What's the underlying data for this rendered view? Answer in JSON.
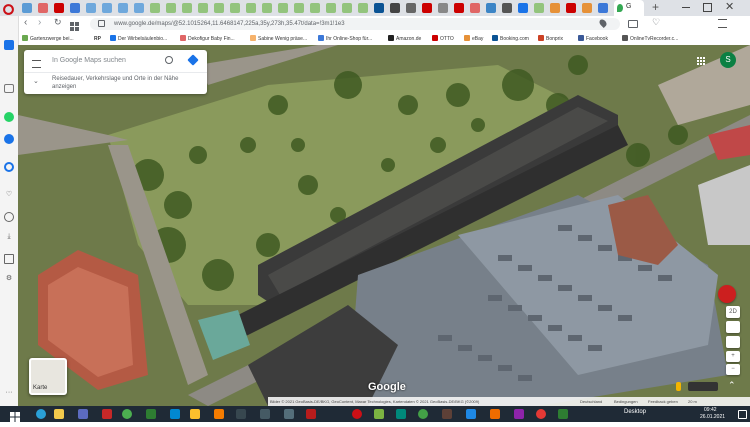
{
  "browser": {
    "url": "www.google.de/maps/@52.1015264,11.6468147,225a,35y,273h,35.47t/data=!3m1!1e3",
    "active_tab_label": "G",
    "new_tab_symbol": "+"
  },
  "bookmarks": [
    {
      "label": "Gartenzwerge bei...",
      "color": "#6aa84f"
    },
    {
      "label": "RP",
      "color": "#333333"
    },
    {
      "label": "Der Wirbelsäulenbio...",
      "color": "#1a73e8"
    },
    {
      "label": "Dekofigur Baby Fin...",
      "color": "#e06666"
    },
    {
      "label": "Sabine Wenig präse...",
      "color": "#f6b26b"
    },
    {
      "label": "Ihr Online-Shop für...",
      "color": "#3c78d8"
    },
    {
      "label": "Amazon.de",
      "color": "#222222"
    },
    {
      "label": "OTTO",
      "color": "#cc0000"
    },
    {
      "label": "eBay",
      "color": "#e69138"
    },
    {
      "label": "Booking.com",
      "color": "#0b5394"
    },
    {
      "label": "Bonprix",
      "color": "#cc4125"
    },
    {
      "label": "Facebook",
      "color": "#3b5998"
    },
    {
      "label": "OnlineTvRecorder.c...",
      "color": "#555555"
    }
  ],
  "search": {
    "placeholder": "In Google Maps suchen",
    "suggestion": "Reisedauer, Verkehrslage und Orte in der Nähe anzeigen"
  },
  "map": {
    "layer_label": "Karte",
    "logo": "Google",
    "attribution": "Bilder © 2021 GeoBasis-DE/BKG, GeoContent, Maxar Technologies, Kartendaten © 2021 GeoBasis-DE/BKG (©2009)",
    "country": "Deutschland",
    "terms": "Bedingungen",
    "feedback": "Feedback geben",
    "scale": "20 m",
    "avatar_letter": "S",
    "tilt_label": "2D"
  },
  "taskbar": {
    "desktop_label": "Desktop",
    "time": "09:42",
    "date": "26.01.2021"
  },
  "colors": {
    "opera_red": "#cc0f16",
    "maps_blue": "#1a73e8",
    "taskbar_bg": "#1f2a36",
    "avatar_green": "#0b8043"
  }
}
